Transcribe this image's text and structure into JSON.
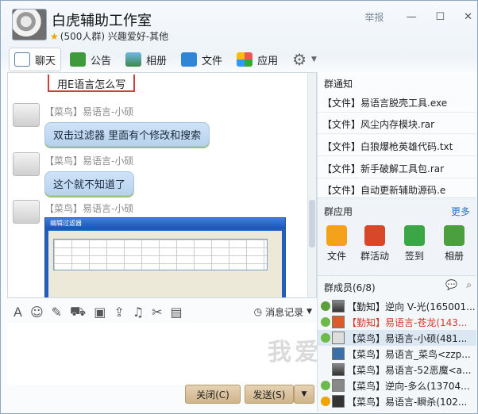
{
  "header": {
    "group_name": "白虎辅助工作室",
    "subline": "(500人群) 兴趣爱好-其他",
    "report": "举报"
  },
  "toolbar": {
    "chat": "聊天",
    "announce": "公告",
    "album": "相册",
    "files": "文件",
    "apps": "应用"
  },
  "chat": {
    "first_bubble": "用E语言怎么写",
    "messages": [
      {
        "sender": "【菜鸟】易语言-小硕",
        "text": "双击过滤器 里面有个修改和搜索"
      },
      {
        "sender": "【菜鸟】易语言-小硕",
        "text": "这个就不知道了"
      },
      {
        "sender": "【菜鸟】易语言-小硕",
        "text": ""
      }
    ],
    "screenshot_title": "编辑过滤器"
  },
  "input_tools": {
    "history": "消息记录"
  },
  "buttons": {
    "close": "关闭(C)",
    "send": "发送(S)"
  },
  "right": {
    "notice_title": "群通知",
    "notices": [
      "【文件】易语言脱壳工具.exe",
      "【文件】风尘内存模块.rar",
      "【文件】白狼爆枪英雄代码.txt",
      "【文件】新手破解工具包.rar",
      "【文件】自动更新辅助源码.e"
    ],
    "apps_title": "群应用",
    "more": "更多",
    "apps": [
      "文件",
      "群活动",
      "签到",
      "相册"
    ],
    "members_title": "群成员(6/8)",
    "members": [
      {
        "name": "【勤知】逆向 V-光(165001...",
        "color": "#222"
      },
      {
        "name": "【勤知】易语言-苍龙(143...",
        "color": "#d23a2a"
      },
      {
        "name": "【菜鸟】易语言-小硕(481...",
        "color": "#222"
      },
      {
        "name": "【菜鸟】易语言_菜鸟<zzp...",
        "color": "#222"
      },
      {
        "name": "【菜鸟】易语言-52恶魔<a...",
        "color": "#222"
      },
      {
        "name": "【菜鸟】逆向-多么(13704...",
        "color": "#222"
      },
      {
        "name": "【菜鸟】易语言-瞬杀(102...",
        "color": "#222"
      }
    ]
  },
  "watermark": "我爱"
}
